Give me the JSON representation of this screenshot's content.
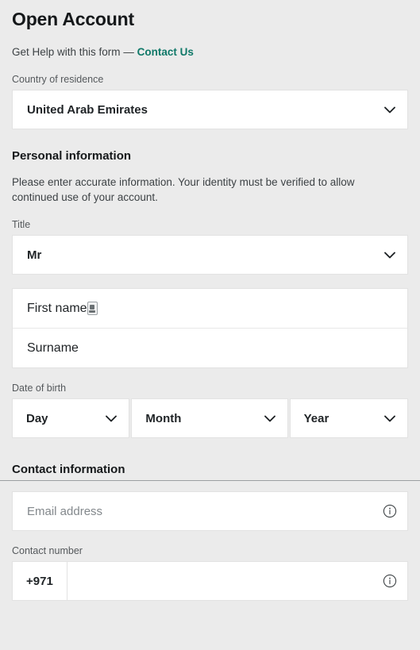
{
  "header": {
    "title": "Open Account"
  },
  "help": {
    "text": "Get Help with this form",
    "dash": "—",
    "link_label": "Contact Us"
  },
  "country": {
    "label": "Country of residence",
    "value": "United Arab Emirates",
    "chevron_icon": "chevron-down-icon"
  },
  "personal": {
    "heading": "Personal information",
    "description": "Please enter accurate information. Your identity must be verified to allow continued use of your account.",
    "title_field": {
      "label": "Title",
      "value": "Mr",
      "chevron_icon": "chevron-down-icon"
    },
    "first_name": {
      "placeholder": "First name",
      "icon": "autofill-card-icon"
    },
    "surname": {
      "placeholder": "Surname"
    },
    "dob": {
      "label": "Date of birth",
      "day": "Day",
      "month": "Month",
      "year": "Year"
    }
  },
  "contact": {
    "heading": "Contact information",
    "email": {
      "placeholder": "Email address",
      "icon": "info-icon"
    },
    "number": {
      "label": "Contact number",
      "country_code": "+971",
      "value": "",
      "icon": "info-icon"
    }
  },
  "colors": {
    "background": "#ebebeb",
    "field_background": "#ffffff",
    "link_accent": "#0f7868",
    "text_primary": "#1f2326",
    "text_secondary": "#55595c",
    "placeholder": "#83888c",
    "border": "#e2e2e2",
    "divider": "#9b9fa1"
  }
}
